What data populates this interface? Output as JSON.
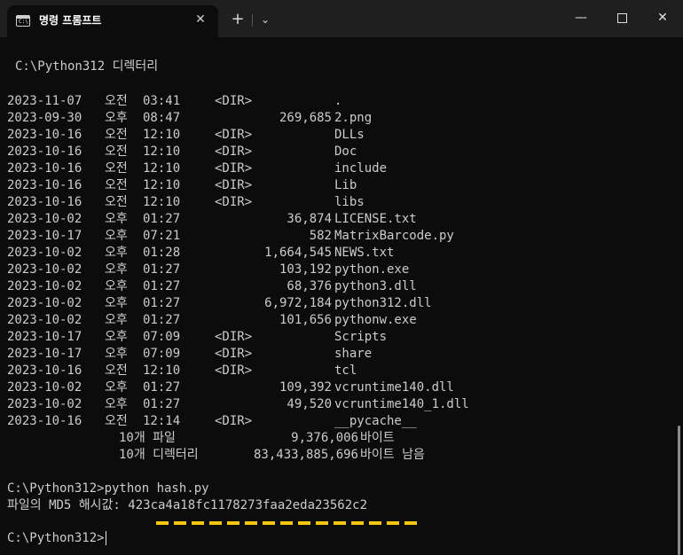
{
  "window": {
    "tab_title": "명령 프롬프트",
    "icon_text": "C:\\"
  },
  "terminal": {
    "dir_header": "C:\\Python312 디렉터리",
    "entries": [
      {
        "date": "2023-11-07",
        "ampm": "오전",
        "time": "03:41",
        "dir": "<DIR>",
        "size": "",
        "name": "."
      },
      {
        "date": "2023-09-30",
        "ampm": "오후",
        "time": "08:47",
        "dir": "",
        "size": "269,685",
        "name": "2.png"
      },
      {
        "date": "2023-10-16",
        "ampm": "오전",
        "time": "12:10",
        "dir": "<DIR>",
        "size": "",
        "name": "DLLs"
      },
      {
        "date": "2023-10-16",
        "ampm": "오전",
        "time": "12:10",
        "dir": "<DIR>",
        "size": "",
        "name": "Doc"
      },
      {
        "date": "2023-10-16",
        "ampm": "오전",
        "time": "12:10",
        "dir": "<DIR>",
        "size": "",
        "name": "include"
      },
      {
        "date": "2023-10-16",
        "ampm": "오전",
        "time": "12:10",
        "dir": "<DIR>",
        "size": "",
        "name": "Lib"
      },
      {
        "date": "2023-10-16",
        "ampm": "오전",
        "time": "12:10",
        "dir": "<DIR>",
        "size": "",
        "name": "libs"
      },
      {
        "date": "2023-10-02",
        "ampm": "오후",
        "time": "01:27",
        "dir": "",
        "size": "36,874",
        "name": "LICENSE.txt"
      },
      {
        "date": "2023-10-17",
        "ampm": "오후",
        "time": "07:21",
        "dir": "",
        "size": "582",
        "name": "MatrixBarcode.py"
      },
      {
        "date": "2023-10-02",
        "ampm": "오후",
        "time": "01:28",
        "dir": "",
        "size": "1,664,545",
        "name": "NEWS.txt"
      },
      {
        "date": "2023-10-02",
        "ampm": "오후",
        "time": "01:27",
        "dir": "",
        "size": "103,192",
        "name": "python.exe"
      },
      {
        "date": "2023-10-02",
        "ampm": "오후",
        "time": "01:27",
        "dir": "",
        "size": "68,376",
        "name": "python3.dll"
      },
      {
        "date": "2023-10-02",
        "ampm": "오후",
        "time": "01:27",
        "dir": "",
        "size": "6,972,184",
        "name": "python312.dll"
      },
      {
        "date": "2023-10-02",
        "ampm": "오후",
        "time": "01:27",
        "dir": "",
        "size": "101,656",
        "name": "pythonw.exe"
      },
      {
        "date": "2023-10-17",
        "ampm": "오후",
        "time": "07:09",
        "dir": "<DIR>",
        "size": "",
        "name": "Scripts"
      },
      {
        "date": "2023-10-17",
        "ampm": "오후",
        "time": "07:09",
        "dir": "<DIR>",
        "size": "",
        "name": "share"
      },
      {
        "date": "2023-10-16",
        "ampm": "오전",
        "time": "12:10",
        "dir": "<DIR>",
        "size": "",
        "name": "tcl"
      },
      {
        "date": "2023-10-02",
        "ampm": "오후",
        "time": "01:27",
        "dir": "",
        "size": "109,392",
        "name": "vcruntime140.dll"
      },
      {
        "date": "2023-10-02",
        "ampm": "오후",
        "time": "01:27",
        "dir": "",
        "size": "49,520",
        "name": "vcruntime140_1.dll"
      },
      {
        "date": "2023-10-16",
        "ampm": "오전",
        "time": "12:14",
        "dir": "<DIR>",
        "size": "",
        "name": "__pycache__"
      }
    ],
    "summary_files": {
      "count": "10개 파일",
      "size": "9,376,006",
      "unit": "바이트"
    },
    "summary_dirs": {
      "count": "10개 디렉터리",
      "size": "83,433,885,696",
      "unit": "바이트 남음"
    },
    "command_line": "C:\\Python312>python hash.py",
    "output_line": "파일의 MD5 해시값: 423ca4a18fc1178273faa2eda23562c2",
    "prompt": "C:\\Python312>"
  },
  "colors": {
    "background": "#0c0c0c",
    "text": "#cccccc",
    "highlight_underline": "#f4c60f"
  }
}
